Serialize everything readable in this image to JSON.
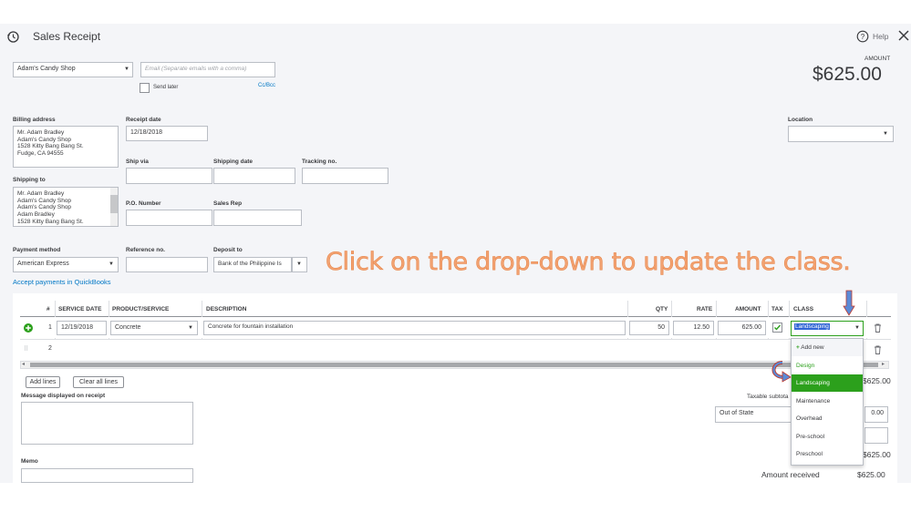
{
  "header": {
    "title": "Sales Receipt",
    "help": "Help",
    "amount_label": "AMOUNT",
    "amount": "$625.00"
  },
  "customer": {
    "value": "Adam's Candy Shop",
    "email_placeholder": "Email (Separate emails with a comma)",
    "send_later": "Send later",
    "ccbcc": "Cc/Bcc"
  },
  "billing": {
    "label": "Billing address",
    "value": "Mr. Adam Bradley\nAdam's Candy Shop\n1528 Kitty Bang Bang St.\nFudge, CA  94555"
  },
  "receipt_date": {
    "label": "Receipt date",
    "value": "12/18/2018"
  },
  "location": {
    "label": "Location"
  },
  "ship_via": {
    "label": "Ship via"
  },
  "shipping_date": {
    "label": "Shipping date"
  },
  "tracking": {
    "label": "Tracking no."
  },
  "shipping_to": {
    "label": "Shipping to",
    "value": "Mr. Adam Bradley\nAdam's Candy Shop\nAdam's Candy Shop\nAdam Bradley\n1528 Kitty Bang Bang St."
  },
  "po": {
    "label": "P.O. Number"
  },
  "sales_rep": {
    "label": "Sales Rep"
  },
  "payment": {
    "label": "Payment method",
    "value": "American Express",
    "accept_link": "Accept payments in QuickBooks"
  },
  "reference": {
    "label": "Reference no."
  },
  "deposit": {
    "label": "Deposit to",
    "value": "Bank of the Philippine Is"
  },
  "callout": "Click on the drop-down to update the class.",
  "table": {
    "headers": {
      "num": "#",
      "service_date": "SERVICE DATE",
      "product": "PRODUCT/SERVICE",
      "description": "DESCRIPTION",
      "qty": "QTY",
      "rate": "RATE",
      "amount": "AMOUNT",
      "tax": "TAX",
      "class": "CLASS"
    },
    "rows": [
      {
        "num": "1",
        "service_date": "12/19/2018",
        "product": "Concrete",
        "description": "Concrete for fountain installation",
        "qty": "50",
        "rate": "12.50",
        "amount": "625.00",
        "class": "Landscaping"
      },
      {
        "num": "2"
      }
    ]
  },
  "buttons": {
    "add_lines": "Add lines",
    "clear_lines": "Clear all lines"
  },
  "message": {
    "label": "Message displayed on receipt"
  },
  "memo": {
    "label": "Memo"
  },
  "class_dropdown": {
    "add_new": "Add new",
    "options": [
      "Design",
      "Landscaping",
      "Maintenance",
      "Overhead",
      "Pre-school",
      "Preschool"
    ],
    "selected": "Landscaping"
  },
  "totals": {
    "subtotal_peek": "$625.00",
    "taxable_subtotal": "Taxable subtota",
    "tax_value": "Out of State",
    "tax_amount": "0.00",
    "total_peek": "$625.00",
    "amount_received_label": "Amount received",
    "amount_received": "$625.00"
  },
  "colors": {
    "accent_green": "#2ca01c",
    "link_blue": "#0077c5",
    "callout_orange": "#f2a373",
    "selection_blue": "#3367d6"
  }
}
